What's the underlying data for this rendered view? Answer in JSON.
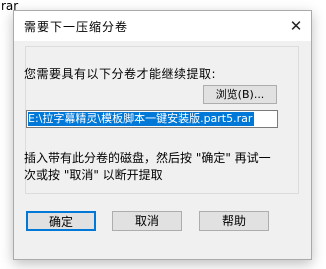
{
  "background_text": "rar",
  "dialog": {
    "title": "需要下一压缩分卷",
    "close_glyph": "✕",
    "prompt": "您需要具有以下分卷才能继续提取:",
    "browse_label": "浏览(B)...",
    "path": "E:\\拉字幕精灵\\模板脚本一键安装版.part5.rar",
    "info": "插入带有此分卷的磁盘，然后按 \"确定\" 再试一次或按 \"取消\" 以断开提取",
    "ok_label": "确定",
    "cancel_label": "取消",
    "help_label": "帮助"
  }
}
